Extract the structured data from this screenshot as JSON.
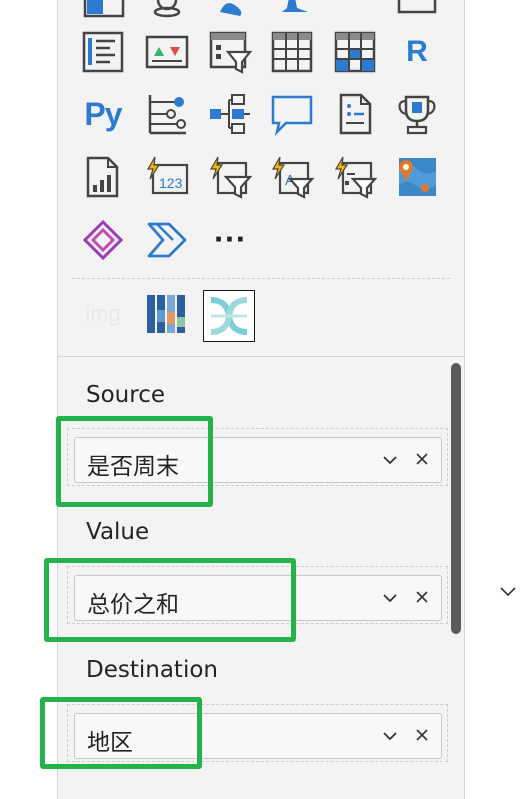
{
  "visual_gallery": {
    "rows": [
      [
        "matrix-partial-icon",
        "map-pin-partial-icon",
        "azure-map-partial-icon",
        "star-partial-icon",
        "narrative-partial-icon"
      ],
      [
        "multirow-card-icon",
        "kpi-icon",
        "slicer-icon",
        "table-icon",
        "matrix-icon",
        "r-visual-icon"
      ],
      [
        "python-visual-icon",
        "key-influencers-icon",
        "decomposition-tree-icon",
        "qa-icon",
        "smart-narrative-icon",
        "goals-icon"
      ],
      [
        "paginated-report-icon",
        "power-kpi-icon",
        "power-slicer-icon",
        "text-filter-icon",
        "hierarchy-slicer-icon",
        "arcgis-map-icon"
      ],
      [
        "power-apps-icon",
        "power-automate-icon",
        "more-visuals-icon"
      ],
      [
        "image-visual-icon",
        "stacked-bar-custom-icon",
        "sankey-chart-icon"
      ]
    ],
    "r_label": "R",
    "python_label": "Py",
    "more_label": "···",
    "img_label": "img",
    "selected": "sankey-chart-icon"
  },
  "field_wells": [
    {
      "label": "Source",
      "value": "是否周末"
    },
    {
      "label": "Value",
      "value": "总价之和"
    },
    {
      "label": "Destination",
      "value": "地区"
    }
  ],
  "colors": {
    "accent_blue": "#2d7bd1",
    "highlight_green": "#24b24a",
    "pane_bg": "#f3f3f3"
  }
}
